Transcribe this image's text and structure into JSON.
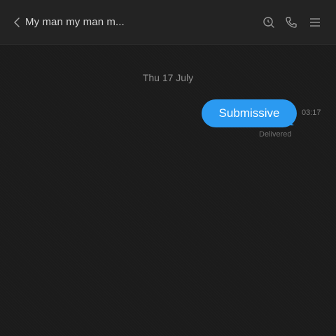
{
  "header": {
    "title": "My man my man m...",
    "back_icon": "chevron-left-icon",
    "actions": [
      "search-icon",
      "phone-icon",
      "menu-icon"
    ]
  },
  "conversation": {
    "date": "Thu 17 July",
    "messages": [
      {
        "text": "Submissive",
        "time": "03:17",
        "status": "Delivered",
        "direction": "outgoing"
      }
    ]
  },
  "colors": {
    "background": "#1b1b1b",
    "header": "#232323",
    "bubble": "#2b9af1"
  }
}
